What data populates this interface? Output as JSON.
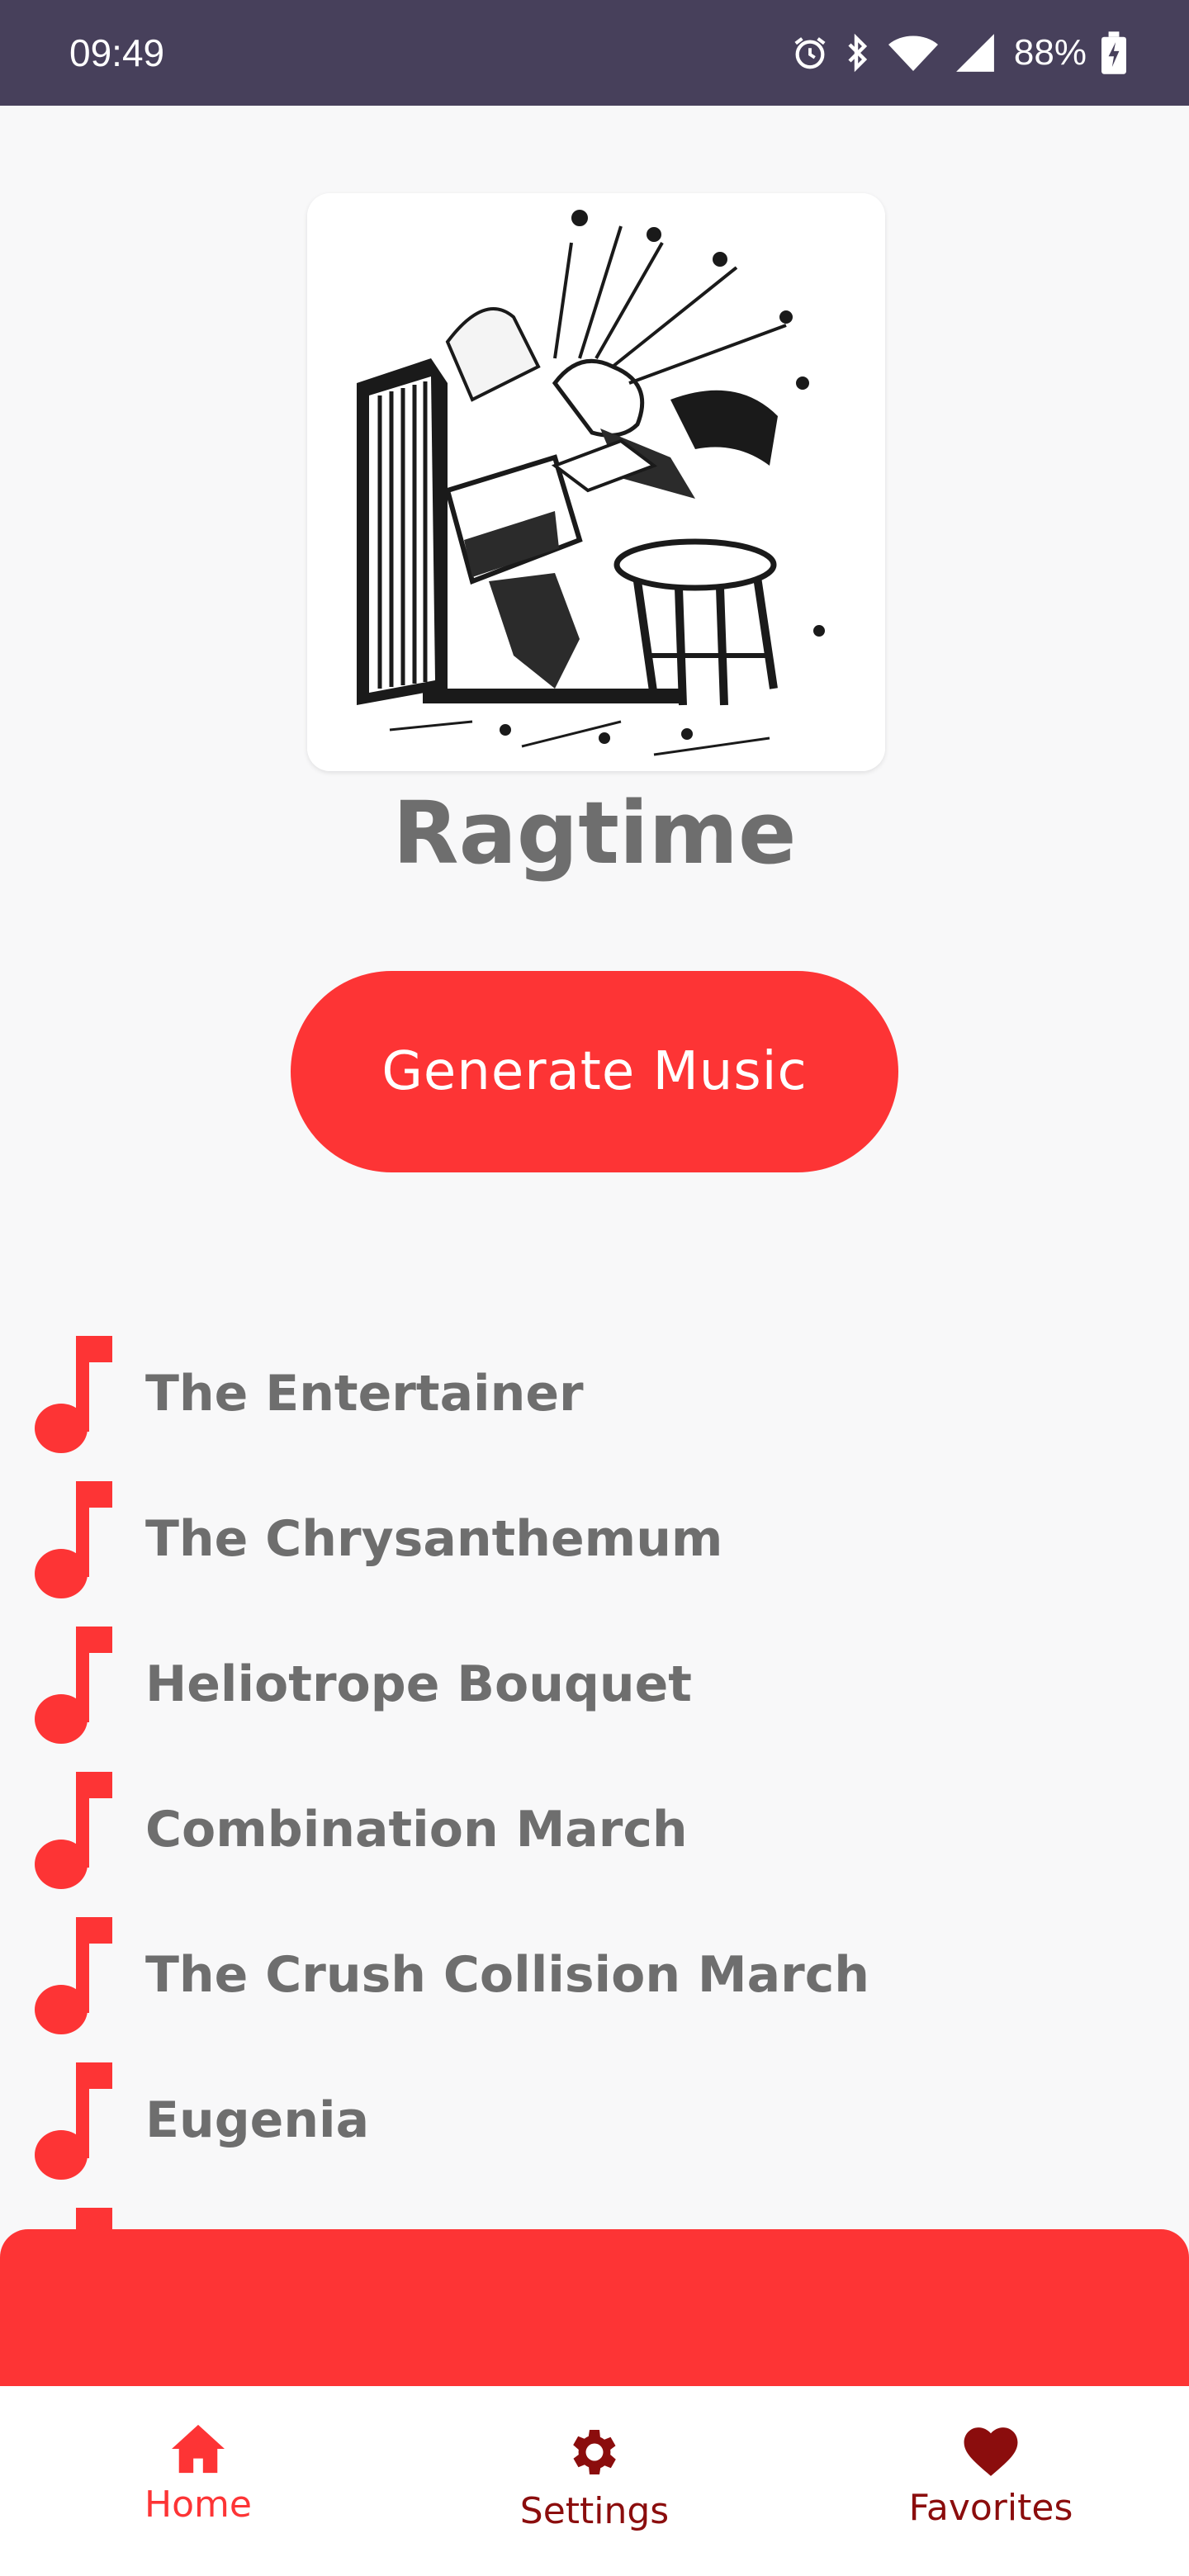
{
  "status_bar": {
    "time": "09:49",
    "battery": "88%",
    "icons": [
      "alarm-icon",
      "bluetooth-icon",
      "wifi-icon",
      "signal-icon",
      "battery-charging-icon"
    ]
  },
  "album_art": {
    "icon": "ragtime-piano-illustration"
  },
  "genre": {
    "title": "Ragtime"
  },
  "generate_button": {
    "label": "Generate Music"
  },
  "songs": [
    {
      "title": "The Entertainer"
    },
    {
      "title": "The Chrysanthemum"
    },
    {
      "title": "Heliotrope Bouquet"
    },
    {
      "title": "Combination March"
    },
    {
      "title": "The Crush Collision March"
    },
    {
      "title": "Eugenia"
    }
  ],
  "bottom_nav": {
    "items": [
      {
        "label": "Home",
        "icon": "home-icon",
        "active": true
      },
      {
        "label": "Settings",
        "icon": "gear-icon",
        "active": false
      },
      {
        "label": "Favorites",
        "icon": "heart-icon",
        "active": false
      }
    ]
  },
  "colors": {
    "accent": "#fd3435",
    "status_bar": "#47405b",
    "nav_active": "#fd3435",
    "nav_inactive": "#8b0d0d",
    "text_gray": "#6e6e6e"
  }
}
